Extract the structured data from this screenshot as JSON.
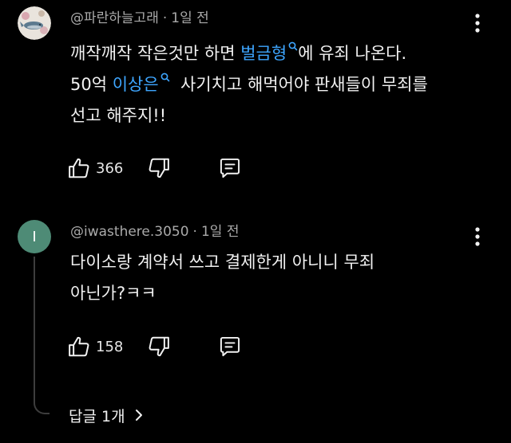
{
  "comments": [
    {
      "author": "@파란하늘고래",
      "separator": "·",
      "time": "1일 전",
      "avatar": {
        "kind": "image",
        "icon": "whale-avatar-icon"
      },
      "lines": [
        {
          "before": "깨작깨작 작은것만 하면 ",
          "link": "벌금형",
          "after": "에 유죄 나온다."
        },
        {
          "before": "50억 ",
          "link": "이상은",
          "after": "  사기치고 해먹어야 판새들이 무죄를"
        },
        {
          "before": "선고 해주지!!",
          "link": "",
          "after": ""
        }
      ],
      "likes": "366"
    },
    {
      "author": "@iwasthere.3050",
      "separator": "·",
      "time": "1일 전",
      "avatar": {
        "kind": "letter",
        "letter": "I",
        "color": "#4e8b76"
      },
      "lines": [
        {
          "before": "다이소랑 계약서 쓰고 결제한게 아니니 무죄",
          "link": "",
          "after": ""
        },
        {
          "before": "아닌가?ㅋㅋ",
          "link": "",
          "after": ""
        }
      ],
      "likes": "158",
      "replies_label": "답글 1개"
    }
  ],
  "theme": {
    "background": "#000000",
    "link_color": "#3ea6ff",
    "meta_color": "#aaaaaa",
    "text_color": "#f1f1f1"
  },
  "icons": [
    "like-icon",
    "dislike-icon",
    "reply-icon",
    "more-vert-icon",
    "search-link-icon",
    "chevron-right-icon"
  ]
}
